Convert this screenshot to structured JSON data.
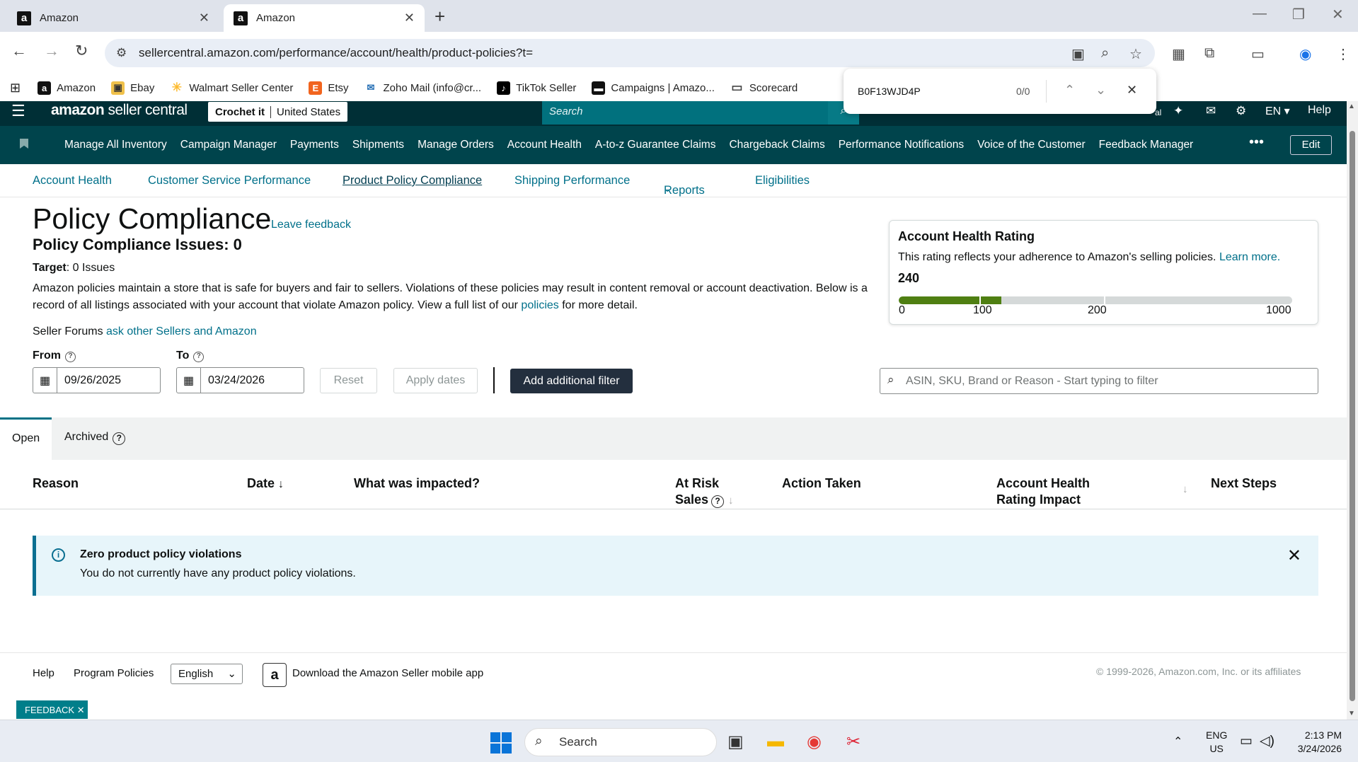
{
  "browser": {
    "tabs": [
      {
        "label": "Amazon"
      },
      {
        "label": "Amazon"
      }
    ],
    "url": "sellercentral.amazon.com/performance/account/health/product-policies?t=",
    "bookmarks": [
      "Amazon",
      "Ebay",
      "Walmart Seller Center",
      "Etsy",
      "Zoho Mail (info@cr...",
      "TikTok Seller",
      "Campaigns | Amazo...",
      "Scorecard"
    ],
    "find": {
      "query": "B0F13WJD4P",
      "count": "0/0"
    }
  },
  "header": {
    "logo_main": "amazon",
    "logo_sub": " seller central",
    "store_name": "Crochet it",
    "store_country": "United States",
    "search_placeholder": "Search",
    "lang": "EN",
    "help": "Help",
    "partial": "al"
  },
  "nav": {
    "items": [
      "Manage All Inventory",
      "Campaign Manager",
      "Payments",
      "Shipments",
      "Manage Orders",
      "Account Health",
      "A-to-z Guarantee Claims",
      "Chargeback Claims",
      "Performance Notifications",
      "Voice of the Customer",
      "Feedback Manager"
    ],
    "edit": "Edit"
  },
  "subnav": {
    "items": [
      "Account Health",
      "Customer Service Performance",
      "Product Policy Compliance",
      "Shipping Performance",
      "Reports",
      "Eligibilities"
    ]
  },
  "page": {
    "title": "Policy Compliance",
    "leave_feedback": "Leave feedback",
    "issues": "Policy Compliance Issues: 0",
    "target_label": "Target",
    "target_value": ": 0 Issues",
    "desc_1": "Amazon policies maintain a store that is safe for buyers and fair to sellers. Violations of these policies may result in content removal or account deactivation. Below is a record of all listings associated with your account that violate Amazon policy. View a full list of our ",
    "desc_link": "policies",
    "desc_2": " for more detail.",
    "forums_label": "Seller Forums ",
    "forums_link": "ask other Sellers and Amazon"
  },
  "rating": {
    "title": "Account Health Rating",
    "text": "This rating reflects your adherence to Amazon's selling policies. ",
    "learn_more": "Learn more.",
    "score": "240",
    "score_fraction": 0.26,
    "ticks": [
      "0",
      "100",
      "200",
      "1000"
    ]
  },
  "filters": {
    "from_label": "From",
    "to_label": "To",
    "from_value": "09/26/2025",
    "to_value": "03/24/2026",
    "reset": "Reset",
    "apply": "Apply dates",
    "add_filter": "Add additional filter",
    "search_placeholder": "ASIN, SKU, Brand or Reason - Start typing to filter"
  },
  "tabs": {
    "open": "Open",
    "archived": "Archived"
  },
  "table": {
    "headers": [
      "Reason",
      "Date",
      "What was impacted?",
      "At Risk",
      "Sales",
      "Action Taken",
      "Account Health",
      "Rating Impact",
      "Next Steps"
    ]
  },
  "alert": {
    "title": "Zero product policy violations",
    "body": "You do not currently have any product policy violations."
  },
  "footer": {
    "help": "Help",
    "program_policies": "Program Policies",
    "language": "English",
    "download": "Download the Amazon Seller mobile app",
    "copyright": "© 1999-2026, Amazon.com, Inc. or its affiliates",
    "feedback": "FEEDBACK"
  },
  "taskbar": {
    "search": "Search",
    "lang_1": "ENG",
    "lang_2": "US",
    "time": "2:13 PM",
    "date": "3/24/2026"
  },
  "colors": {
    "header": "#002f36",
    "nav": "#00444c",
    "link": "#00708a",
    "rating_fill": "#4f7f12"
  }
}
